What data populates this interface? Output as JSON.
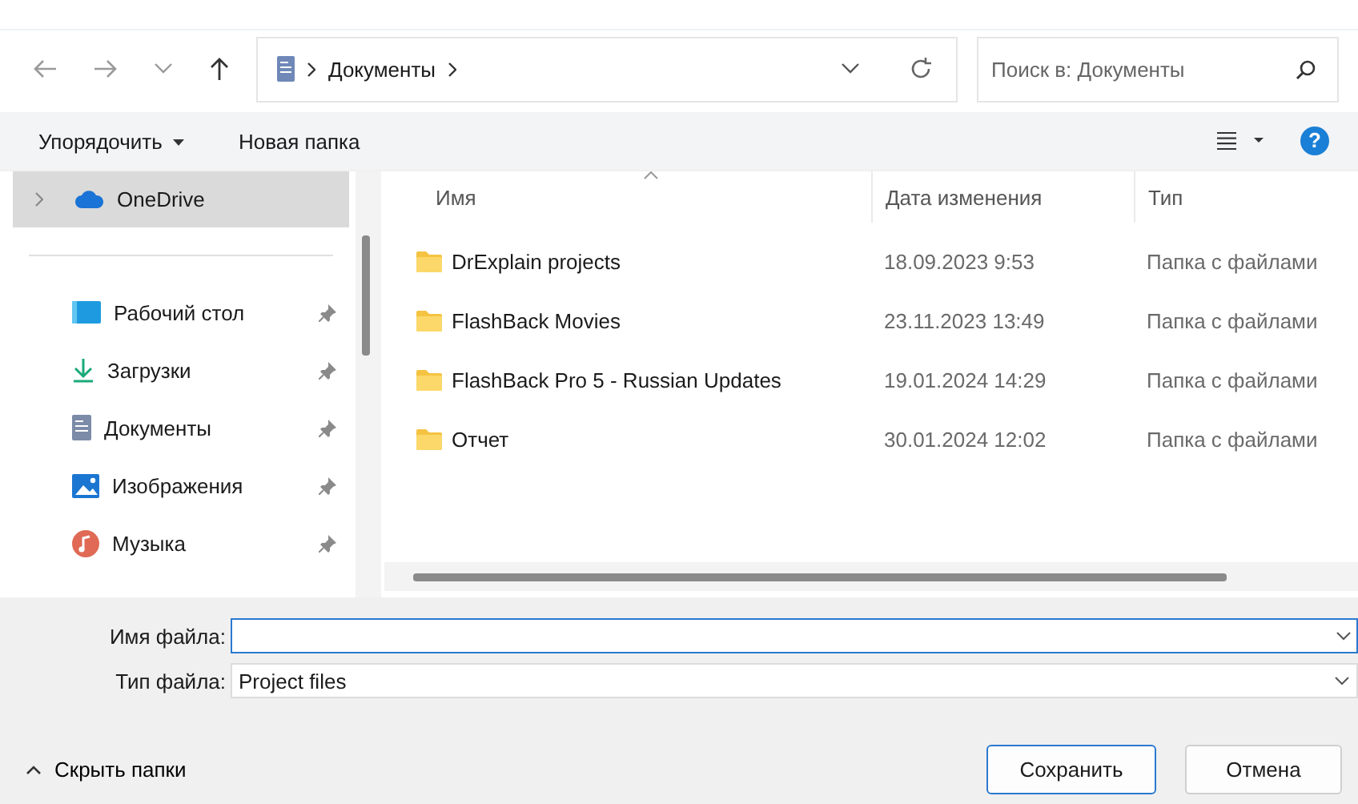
{
  "address": {
    "crumbs": [
      "Документы"
    ]
  },
  "search": {
    "placeholder": "Поиск в: Документы"
  },
  "toolbar": {
    "organize": "Упорядочить",
    "new_folder": "Новая папка",
    "help": "?"
  },
  "sidebar": {
    "items": [
      {
        "label": "OneDrive",
        "kind": "cloud",
        "selected": true,
        "pinned": false
      },
      {
        "label": "Рабочий стол",
        "kind": "desktop",
        "selected": false,
        "pinned": true
      },
      {
        "label": "Загрузки",
        "kind": "downloads",
        "selected": false,
        "pinned": true
      },
      {
        "label": "Документы",
        "kind": "documents",
        "selected": false,
        "pinned": true
      },
      {
        "label": "Изображения",
        "kind": "pictures",
        "selected": false,
        "pinned": true
      },
      {
        "label": "Музыка",
        "kind": "music",
        "selected": false,
        "pinned": true
      }
    ]
  },
  "table": {
    "columns": [
      "Имя",
      "Дата изменения",
      "Тип"
    ],
    "rows": [
      {
        "name": "DrExplain projects",
        "date": "18.09.2023 9:53",
        "type": "Папка с файлами"
      },
      {
        "name": "FlashBack Movies",
        "date": "23.11.2023 13:49",
        "type": "Папка с файлами"
      },
      {
        "name": "FlashBack Pro 5 - Russian Updates",
        "date": "19.01.2024 14:29",
        "type": "Папка с файлами"
      },
      {
        "name": "Отчет",
        "date": "30.01.2024 12:02",
        "type": "Папка с файлами"
      }
    ]
  },
  "form": {
    "filename_label": "Имя файла:",
    "filetype_label": "Тип файла:",
    "filetype": "Project files"
  },
  "footer": {
    "hide_folders": "Скрыть папки",
    "buttons": [
      {
        "label": "Сохранить",
        "default": true
      },
      {
        "label": "Отмена",
        "default": false
      }
    ]
  }
}
